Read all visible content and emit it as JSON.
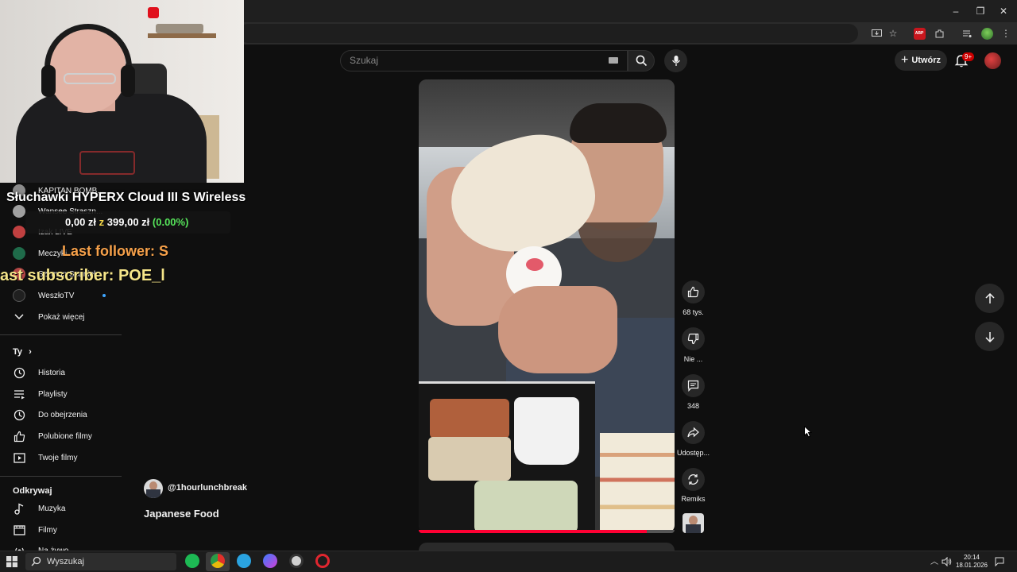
{
  "browser": {
    "window_controls": {
      "minimize": "–",
      "restore": "❐",
      "close": "✕"
    },
    "toolbar_icons": [
      "install-icon",
      "star-icon",
      "adblock-icon",
      "extensions-icon",
      "media-icon",
      "profile-icon",
      "menu-icon"
    ],
    "adblock_label": "ABP"
  },
  "masthead": {
    "search_placeholder": "Szukaj",
    "create_label": "Utwórz",
    "notification_badge": "9+"
  },
  "overlay": {
    "headset_title": "Słuchawki HYPERX Cloud III S Wireless",
    "goal_current": "0,00 zł",
    "goal_sep": "z",
    "goal_target": "399,00 zł",
    "goal_percent": "(0.00%)",
    "last_follower": "Last follower: S",
    "last_subscriber": "ast subscriber: POE_l"
  },
  "sidebar": {
    "subscriptions": [
      {
        "label": "KAPITAN BOMB...",
        "avatar_color": "#8a8a8a"
      },
      {
        "label": "Wansee Straszn...",
        "avatar_color": "#a0a0a0"
      },
      {
        "label": "Izak LIVE",
        "avatar_color": "#c04040"
      },
      {
        "label": "Meczyki",
        "avatar_color": "#1f6b4a"
      },
      {
        "label": "Szymon Spaniel...",
        "avatar_color": "#b04545"
      },
      {
        "label": "WeszłoTV",
        "avatar_color": "#202020"
      }
    ],
    "show_more": "Pokaż więcej",
    "you_section": "Ty",
    "you_items": [
      {
        "label": "Historia",
        "icon": "history-icon"
      },
      {
        "label": "Playlisty",
        "icon": "playlist-icon"
      },
      {
        "label": "Do obejrzenia",
        "icon": "watch-later-icon"
      },
      {
        "label": "Polubione filmy",
        "icon": "like-icon"
      },
      {
        "label": "Twoje filmy",
        "icon": "your-videos-icon"
      }
    ],
    "explore_section": "Odkrywaj",
    "explore_items": [
      {
        "label": "Muzyka",
        "icon": "music-icon"
      },
      {
        "label": "Filmy",
        "icon": "movies-icon"
      },
      {
        "label": "Na żywo",
        "icon": "live-icon"
      }
    ]
  },
  "short": {
    "channel": "@1hourlunchbreak",
    "title": "Japanese Food",
    "progress": 0.89,
    "actions": {
      "like_count": "68 tys.",
      "dislike_label": "Nie ...",
      "comment_count": "348",
      "share_label": "Udostęp...",
      "remix_label": "Remiks"
    }
  },
  "taskbar": {
    "search_text": "Wyszukaj",
    "apps": [
      {
        "name": "spotify",
        "color": "#1db954"
      },
      {
        "name": "chrome",
        "color": "#e8b90c"
      },
      {
        "name": "telegram",
        "color": "#2aa3e0"
      },
      {
        "name": "messenger",
        "color": "#a24cf0"
      },
      {
        "name": "clock-app",
        "color": "#d0d0d0"
      },
      {
        "name": "opera",
        "color": "#e0262f"
      }
    ],
    "time": "20:14",
    "date": "18.01.2026"
  }
}
